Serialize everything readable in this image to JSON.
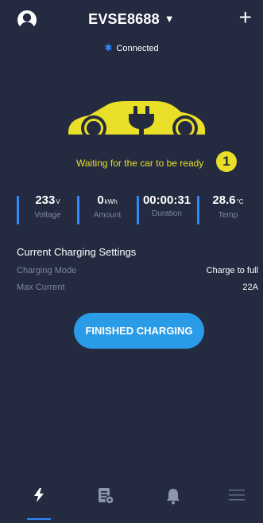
{
  "header": {
    "device_name": "EVSE8688",
    "caret": "▼",
    "add_label": "+",
    "avatar_icon": "user-avatar-icon"
  },
  "connection": {
    "bluetooth_glyph": "✱",
    "status": "Connected"
  },
  "charger": {
    "status_message": "Waiting for the car to be ready",
    "step_badge": "1",
    "car_icon": "car-plug-icon",
    "car_color": "#e9df29"
  },
  "stats": [
    {
      "value": "233",
      "unit": "V",
      "label": "Voltage"
    },
    {
      "value": "0",
      "unit": "kWh",
      "label": "Amount"
    },
    {
      "value": "00:00:31",
      "unit": "",
      "label": "Duration"
    },
    {
      "value": "28.6",
      "unit": "°C",
      "label": "Temp"
    }
  ],
  "settings": {
    "title": "Current Charging Settings",
    "rows": [
      {
        "key": "Charging Mode",
        "value": "Charge to full"
      },
      {
        "key": "Max Current",
        "value": "22A"
      }
    ]
  },
  "actions": {
    "finish_label": "FINISHED CHARGING"
  },
  "tabbar": {
    "tabs": [
      {
        "name": "charging",
        "icon": "lightning-icon",
        "active": true
      },
      {
        "name": "records",
        "icon": "records-icon",
        "active": false
      },
      {
        "name": "notifications",
        "icon": "bell-icon",
        "active": false
      },
      {
        "name": "menu",
        "icon": "menu-icon",
        "active": false
      }
    ]
  },
  "colors": {
    "background": "#242a3f",
    "accent": "#2f88ff",
    "button": "#2a9be6",
    "yellow": "#e9df29",
    "muted": "#7c87a6"
  }
}
